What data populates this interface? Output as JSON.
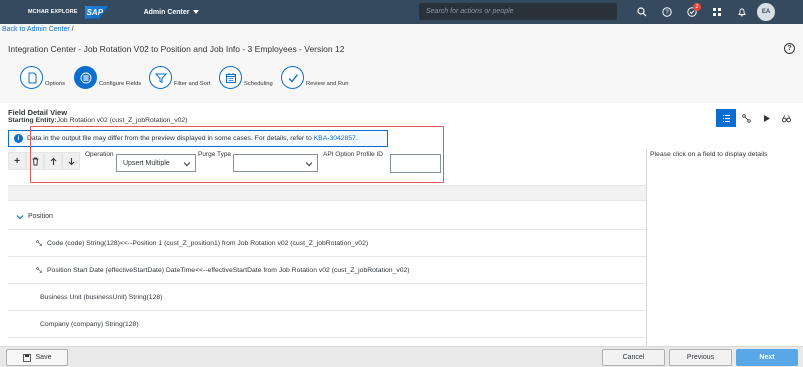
{
  "shell": {
    "brand": "MCHAR EXPLORE",
    "logo": "SAP",
    "admin_menu": "Admin Center",
    "search_placeholder": "Search for actions or people",
    "notification_count": "2",
    "avatar_initials": "EA"
  },
  "breadcrumb": {
    "link": "Back to Admin Center",
    "separator": "/"
  },
  "page": {
    "title": "Integration Center - Job Rotation V02 to Position and Job Info - 3 Employees - Version 12",
    "help": "?"
  },
  "wizard": {
    "steps": [
      {
        "label": "Options",
        "icon": "document-icon",
        "active": false
      },
      {
        "label": "Configure Fields",
        "icon": "grid-icon",
        "active": true
      },
      {
        "label": "Filter and Sort",
        "icon": "filter-icon",
        "active": false
      },
      {
        "label": "Scheduling",
        "icon": "calendar-icon",
        "active": false
      },
      {
        "label": "Review and Run",
        "icon": "checkmark-icon",
        "active": false
      }
    ]
  },
  "field_detail": {
    "title": "Field Detail View",
    "entity_label": "Starting Entity:",
    "entity_value": "Job Rotation v02 (cust_Z_jobRotation_v02)",
    "info_text": "Data in the output file may differ from the preview displayed in some cases. For details, refer to ",
    "info_link": "KBA-3042857",
    "info_end": "."
  },
  "toolbar": {
    "add": "+",
    "operation_label": "Operation",
    "operation_value": "Upsert Multiple",
    "purge_label": "Purge Type",
    "purge_value": "",
    "api_label": "API Option Profile ID",
    "api_value": ""
  },
  "grid": {
    "group": "Position",
    "rows": [
      {
        "text": "Code (code) String(128)<<--Position 1 (cust_Z_position1) from Job Rotation v02 (cust_Z_jobRotation_v02)",
        "mapped": true
      },
      {
        "text": "Position Start Date (effectiveStartDate) DateTime<<--effectiveStartDate from Job Rotation v02 (cust_Z_jobRotation_v02)",
        "mapped": true
      },
      {
        "text": "Business Unit (businessUnit) String(128)",
        "mapped": false
      },
      {
        "text": "Company (company) String(128)",
        "mapped": false
      }
    ]
  },
  "right_pane": {
    "hint": "Please click on a field to display details"
  },
  "footer": {
    "save": "Save",
    "cancel": "Cancel",
    "previous": "Previous",
    "next": "Next"
  },
  "colors": {
    "shell": "#354a5f",
    "accent": "#0a6ed1",
    "highlight": "#e05a5a",
    "next": "#5aa7e8"
  }
}
